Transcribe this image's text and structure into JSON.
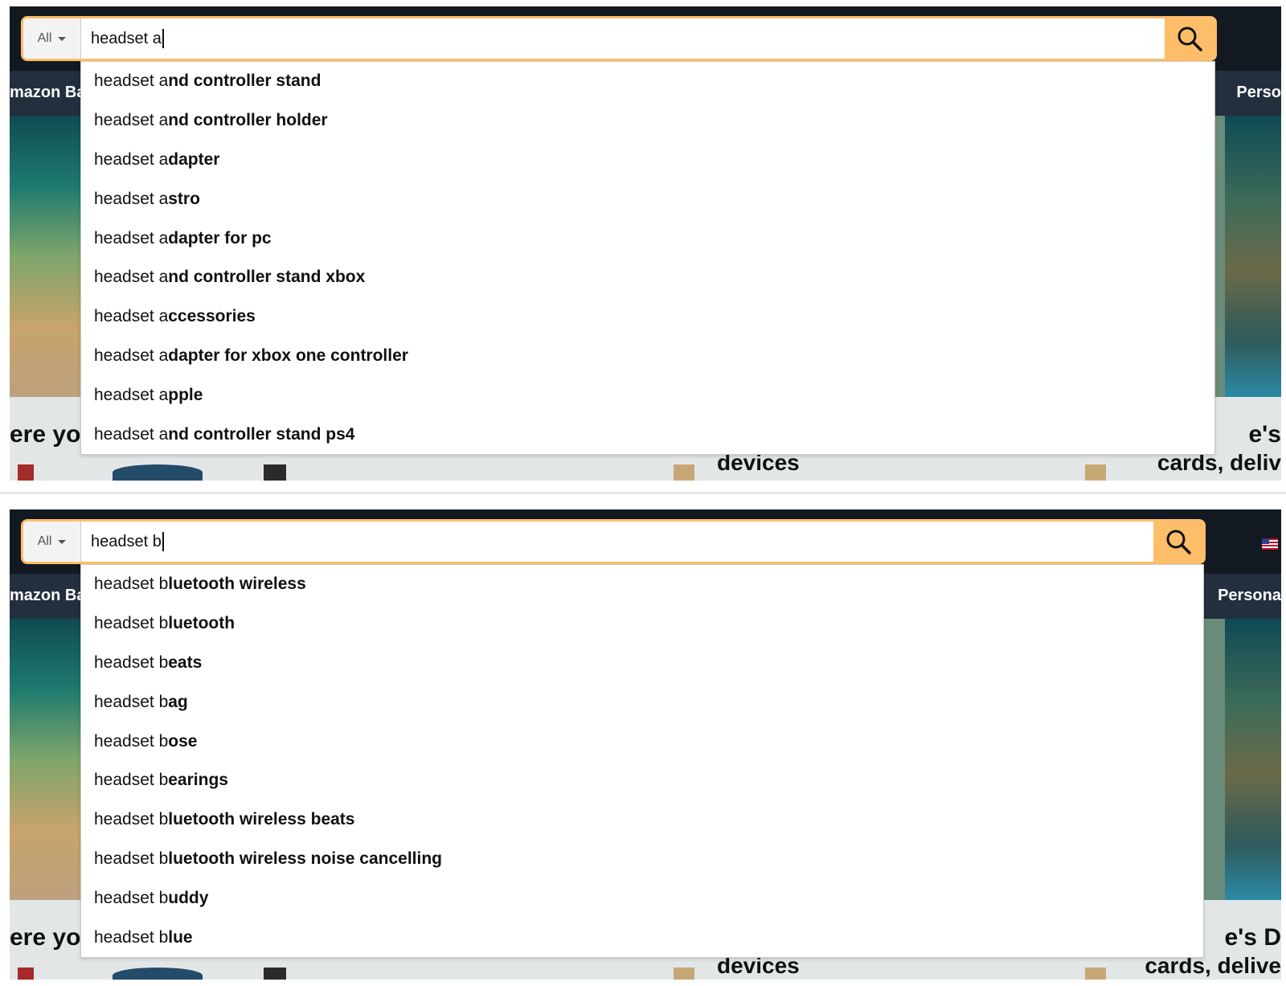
{
  "panels": [
    {
      "query": "headset a",
      "department": "All",
      "nav_left": "mazon Bas",
      "nav_right": "Perso",
      "cards": {
        "left": "ere yo",
        "mid": "devices",
        "right_1": "e's",
        "right_2": "cards, deliv"
      },
      "suggestions": [
        {
          "prefix": "headset a",
          "rest": "nd controller stand"
        },
        {
          "prefix": "headset a",
          "rest": "nd controller holder"
        },
        {
          "prefix": "headset a",
          "rest": "dapter"
        },
        {
          "prefix": "headset a",
          "rest": "stro"
        },
        {
          "prefix": "headset a",
          "rest": "dapter for pc"
        },
        {
          "prefix": "headset a",
          "rest": "nd controller stand xbox"
        },
        {
          "prefix": "headset a",
          "rest": "ccessories"
        },
        {
          "prefix": "headset a",
          "rest": "dapter for xbox one controller"
        },
        {
          "prefix": "headset a",
          "rest": "pple"
        },
        {
          "prefix": "headset a",
          "rest": "nd controller stand ps4"
        }
      ]
    },
    {
      "query": "headset b",
      "department": "All",
      "nav_left": "mazon Bas",
      "nav_right": "Persona",
      "cards": {
        "left": "ere yo",
        "mid": "devices",
        "right_1": "e's D",
        "right_2": "cards, delive"
      },
      "suggestions": [
        {
          "prefix": "headset b",
          "rest": "luetooth wireless"
        },
        {
          "prefix": "headset b",
          "rest": "luetooth"
        },
        {
          "prefix": "headset b",
          "rest": "eats"
        },
        {
          "prefix": "headset b",
          "rest": "ag"
        },
        {
          "prefix": "headset b",
          "rest": "ose"
        },
        {
          "prefix": "headset b",
          "rest": "earings"
        },
        {
          "prefix": "headset b",
          "rest": "luetooth wireless beats"
        },
        {
          "prefix": "headset b",
          "rest": "luetooth wireless noise cancelling"
        },
        {
          "prefix": "headset b",
          "rest": "uddy"
        },
        {
          "prefix": "headset b",
          "rest": "lue"
        }
      ]
    }
  ],
  "colors": {
    "accent": "#febd69",
    "nav": "#131921",
    "subnav": "#232f3e",
    "text": "#0f1111"
  },
  "icons": {
    "search": "magnifier-icon",
    "dept_caret": "caret-down-icon",
    "flag": "us-flag-icon"
  }
}
